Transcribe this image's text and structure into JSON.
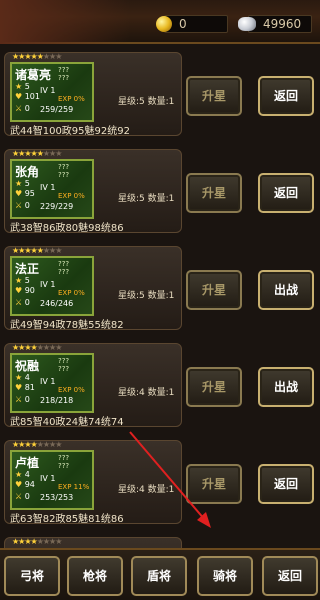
{
  "currency": {
    "gold": "0",
    "silver": "49960"
  },
  "heroes": [
    {
      "name": "诸葛亮",
      "stars": 5,
      "level_mark": "5",
      "hp_left": "101",
      "bottom_left": "0",
      "iv": "IV 1",
      "exp": "EXP 0%",
      "hp": "259/259",
      "q1": "???",
      "q2": "???",
      "info": "星级:5 数量:1",
      "stats": "武44智100政95魅92统92",
      "upgrade": "升星",
      "action": "返回"
    },
    {
      "name": "张角",
      "stars": 5,
      "level_mark": "5",
      "hp_left": "95",
      "bottom_left": "0",
      "iv": "IV 1",
      "exp": "EXP 0%",
      "hp": "229/229",
      "q1": "???",
      "q2": "???",
      "info": "星级:5 数量:1",
      "stats": "武38智86政80魅98统86",
      "upgrade": "升星",
      "action": "返回"
    },
    {
      "name": "法正",
      "stars": 5,
      "level_mark": "5",
      "hp_left": "90",
      "bottom_left": "0",
      "iv": "IV 1",
      "exp": "EXP 0%",
      "hp": "246/246",
      "q1": "???",
      "q2": "???",
      "info": "星级:5 数量:1",
      "stats": "武49智94政78魅55统82",
      "upgrade": "升星",
      "action": "出战"
    },
    {
      "name": "祝融",
      "stars": 4,
      "level_mark": "4",
      "hp_left": "81",
      "bottom_left": "0",
      "iv": "IV 1",
      "exp": "EXP 0%",
      "hp": "218/218",
      "q1": "???",
      "q2": "???",
      "info": "星级:4 数量:1",
      "stats": "武85智40政24魅74统74",
      "upgrade": "升星",
      "action": "出战"
    },
    {
      "name": "卢植",
      "stars": 4,
      "level_mark": "4",
      "hp_left": "94",
      "bottom_left": "0",
      "iv": "IV 1",
      "exp": "EXP 11%",
      "hp": "253/253",
      "q1": "???",
      "q2": "???",
      "info": "星级:4 数量:1",
      "stats": "武63智82政85魅81统86",
      "upgrade": "升星",
      "action": "返回"
    }
  ],
  "partial_card_stars": 4,
  "tabs": [
    "弓将",
    "枪将",
    "盾将",
    "骑将",
    "返回"
  ],
  "arrow_color": "#e02020"
}
